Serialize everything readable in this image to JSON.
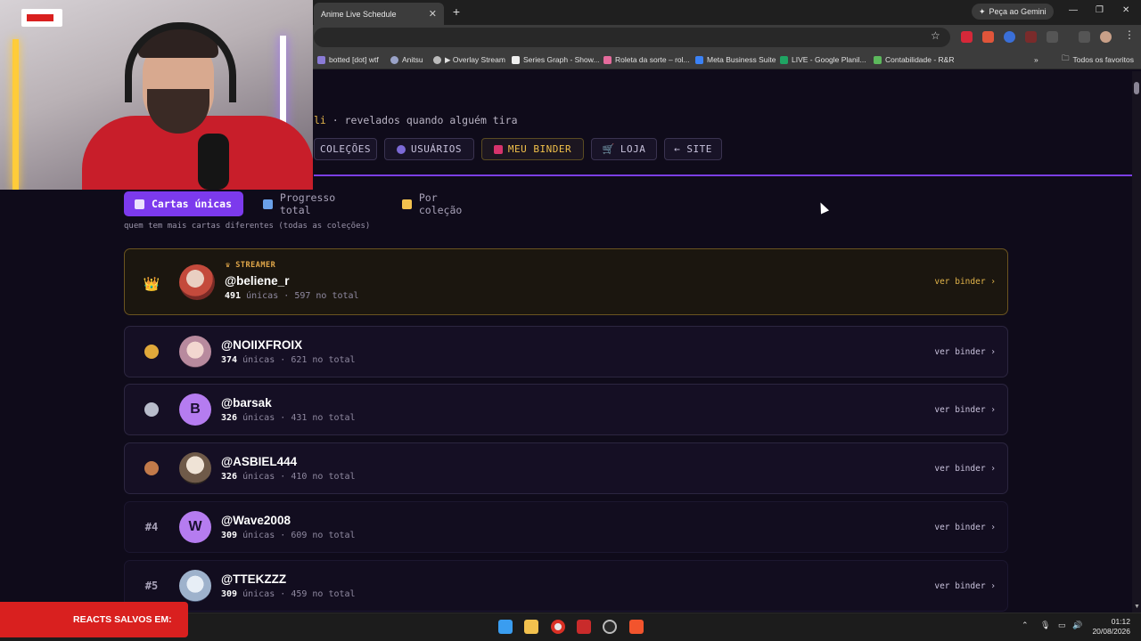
{
  "browser": {
    "tab_title": "Anime Live Schedule",
    "tab_close": "✕",
    "new_tab": "+",
    "gemini_label": "Peça ao Gemini",
    "bookmarks": [
      "botted [dot] wtf",
      "Anitsu",
      "▶ Overlay Stream",
      "Series Graph - Show...",
      "Roleta da sorte – rol...",
      "Meta Business Suite",
      "LIVE - Google Planil...",
      "Contabilidade - R&R"
    ],
    "bookmarks_more": "»",
    "all_bookmarks": "Todos os favoritos"
  },
  "header": {
    "subtitle_accent": "li",
    "subtitle_rest": " · revelados quando alguém tira"
  },
  "nav": {
    "colecoes": "COLEÇÕES",
    "usuarios": "USUÁRIOS",
    "meu_binder": "MEU BINDER",
    "loja": "LOJA",
    "site": "← SITE"
  },
  "subtabs": {
    "cartas_unicas": "Cartas únicas",
    "progresso_total": "Progresso total",
    "por_colecao": "Por coleção"
  },
  "hint": "quem tem mais cartas diferentes (todas as coleções)",
  "leaderboard": {
    "unicas_label": "únicas",
    "total_label": "no total",
    "separator": "·",
    "ver_binder": "ver binder ›",
    "streamer_badge": "STREAMER",
    "rows": [
      {
        "rank": "",
        "handle": "@beliene_r",
        "unicas": "491",
        "total": "597",
        "initial": ""
      },
      {
        "rank": "",
        "handle": "@NOIIXFROIX",
        "unicas": "374",
        "total": "621",
        "initial": ""
      },
      {
        "rank": "",
        "handle": "@barsak",
        "unicas": "326",
        "total": "431",
        "initial": "B"
      },
      {
        "rank": "",
        "handle": "@ASBIEL444",
        "unicas": "326",
        "total": "410",
        "initial": ""
      },
      {
        "rank": "#4",
        "handle": "@Wave2008",
        "unicas": "309",
        "total": "609",
        "initial": "W"
      },
      {
        "rank": "#5",
        "handle": "@TTEKZZZ",
        "unicas": "309",
        "total": "459",
        "initial": ""
      }
    ]
  },
  "medals": {
    "top_icon": "👑",
    "gold": "1",
    "silver": "2",
    "bronze": "3"
  },
  "banner": {
    "text": "REACTS SALVOS EM:"
  },
  "clock": {
    "time": "01:12",
    "date": "20/08/2026"
  },
  "colors": {
    "accent_purple": "#7c3aed",
    "gold": "#e2b44a",
    "background": "#0f0b1a"
  }
}
